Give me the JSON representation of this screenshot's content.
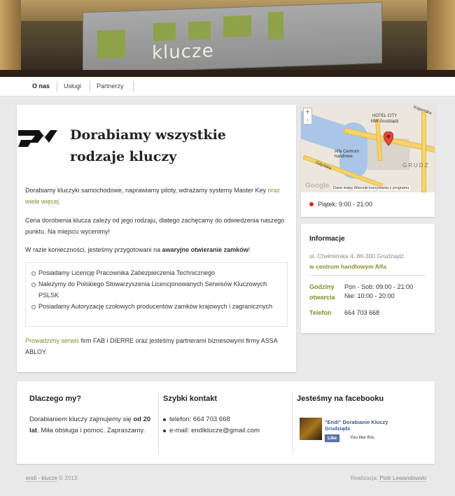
{
  "nav": {
    "items": [
      {
        "label": "O nas",
        "active": true
      },
      {
        "label": "Usługi",
        "active": false
      },
      {
        "label": "Partnerzy",
        "active": false
      }
    ]
  },
  "banner": {
    "sign_text": "klucze"
  },
  "main": {
    "title": "Dorabiamy wszystkie rodzaje kluczy",
    "p1_text": "Dorabiamy kluczyki samochodowe, naprawiamy piloty, wdrażamy systemy Master Key ",
    "p1_link": "oraz wiele więcej.",
    "p2": "Cena dorobienia klucza zależy od jego rodzaju, dlatego zachęcamy do odwiedzenia naszego punktu. Na miejscu wycenimy!",
    "p3_text": "W razie konieczności, jesteśmy przygotowani na ",
    "p3_bold": "awaryjne otwieranie zamków",
    "p3_end": "!",
    "bullets": [
      "Posiadamy Licencję Pracownika Zabezpieczenia Technicznego",
      "Należymy do Polskiego Stowarzyszenia Licencjonowanych Serwisów Kluczowych PSLSK",
      "Posiadamy Autoryzację czołowych producentów zamków krajowych i zagranicznych"
    ],
    "p4_link": "Prowadzimy serwis",
    "p4_text": " firm FAB i DIERRE oraz jesteśmy partnerami biznesowymi firmy ASSA ABLOY."
  },
  "map": {
    "zoom_in": "+",
    "zoom_out": "-",
    "labels": {
      "hotel": "HOTEL CITY",
      "mw": "MW Grudziądz",
      "alfa": "Alfa Centrum handlowe",
      "grudz": "GRUDZ",
      "gdynska": "Gdyńska",
      "kopernika": "Kopernika"
    },
    "google": "Google",
    "terms": "Dane mapy  Warunki korzystania z programu",
    "hours": "Piątek: 9:00 - 21:00",
    "open_color": "#dd2222"
  },
  "info": {
    "title": "Informacje",
    "address": "ul. Chełmińska 4, 86-300 Grudziądz",
    "address2": "w centrum handlowym Alfa",
    "hours_label_1": "Godziny",
    "hours_label_2": "otwarcia",
    "hours_1": "Pon - Sob: 09:00 - 21:00",
    "hours_2": "Nie: 10:00 - 20:00",
    "phone_label": "Telefon",
    "phone": "664 703 668"
  },
  "bottom": {
    "why_title": "Dlaczego my?",
    "why_text_1": "Dorabianiem kluczy zajmujemy się ",
    "why_bold": "od 20 lat",
    "why_text_2": ". Miła obsługa i pomoc. Zapraszamy.",
    "contact_title": "Szybki kontakt",
    "contact_items": [
      "telefon: 664 703 668",
      "e-mail: endiklucze@gmail.com"
    ],
    "fb_title": "Jesteśmy na facebooku",
    "fb_name": "\"Endi\" Dorabianie Kluczy Grudziądz",
    "fb_like": "Like",
    "fb_you": "You like this."
  },
  "footer": {
    "left_link": "endi - klucze",
    "left_text": " © 2013",
    "right_text": "Realizacja: ",
    "right_link": "Piotr Lewandowski"
  },
  "colors": {
    "accent_olive": "#8a8a2a",
    "fb_blue": "#3b5998"
  }
}
